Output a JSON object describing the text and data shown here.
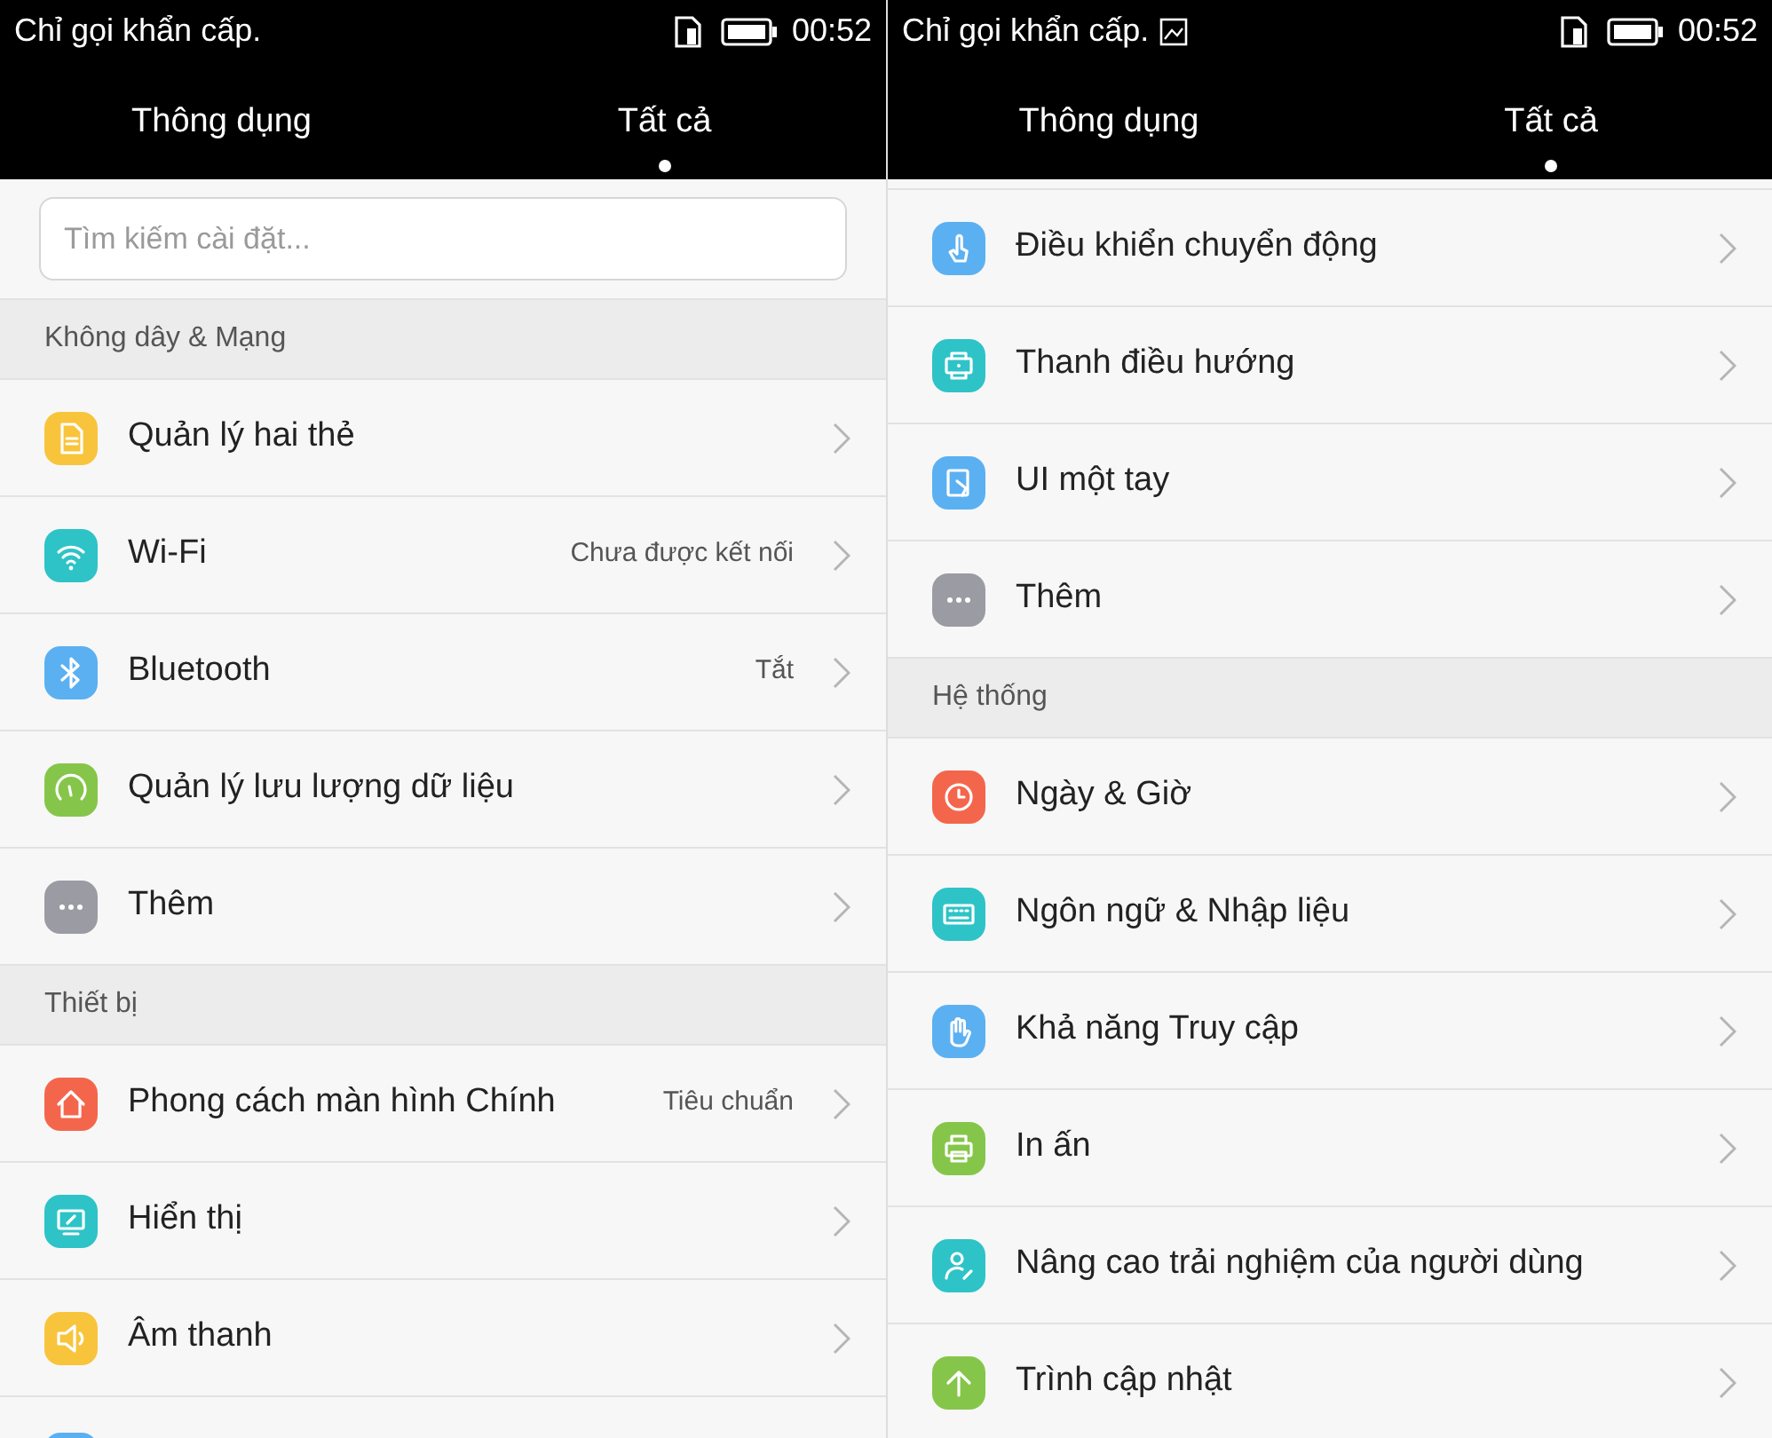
{
  "screens": [
    {
      "status_bar": {
        "carrier": "Chỉ gọi khẩn cấp.",
        "image_notification": false,
        "time": "00:52"
      },
      "tabs": [
        {
          "label": "Thông dụng",
          "selected": false
        },
        {
          "label": "Tất cả",
          "selected": true
        }
      ],
      "search": {
        "placeholder": "Tìm kiếm cài đặt..."
      },
      "sections": [
        {
          "header": "Không dây & Mạng",
          "rows": [
            {
              "kind": "sim",
              "color": "#f8c43c",
              "label": "Quản lý hai thẻ"
            },
            {
              "kind": "wifi",
              "color": "#2ec3c7",
              "label": "Wi-Fi",
              "value": "Chưa được kết nối"
            },
            {
              "kind": "bluetooth",
              "color": "#5bb0f2",
              "label": "Bluetooth",
              "value": "Tắt"
            },
            {
              "kind": "gauge",
              "color": "#85c64a",
              "label": "Quản lý lưu lượng dữ liệu"
            },
            {
              "kind": "more",
              "color": "#9b9ba3",
              "label": "Thêm"
            }
          ]
        },
        {
          "header": "Thiết bị",
          "rows": [
            {
              "kind": "home",
              "color": "#f4664c",
              "label": "Phong cách màn hình Chính",
              "value": "Tiêu chuẩn"
            },
            {
              "kind": "display",
              "color": "#2ec3c7",
              "label": "Hiển thị"
            },
            {
              "kind": "sound",
              "color": "#f8c43c",
              "label": "Âm thanh"
            },
            {
              "kind": "blank",
              "color": "#5bb0f2"
            }
          ]
        }
      ]
    },
    {
      "status_bar": {
        "carrier": "Chỉ gọi khẩn cấp.",
        "image_notification": true,
        "time": "00:52"
      },
      "tabs": [
        {
          "label": "Thông dụng",
          "selected": false
        },
        {
          "label": "Tất cả",
          "selected": true
        }
      ],
      "sections": [
        {
          "rows": [
            {
              "kind": "gesture",
              "color": "#5bb0f2",
              "label": "Điều khiển chuyển động"
            },
            {
              "kind": "navbar",
              "color": "#2ec3c7",
              "label": "Thanh điều hướng"
            },
            {
              "kind": "onehand",
              "color": "#5bb0f2",
              "label": "UI một tay"
            },
            {
              "kind": "more",
              "color": "#9b9ba3",
              "label": "Thêm"
            }
          ]
        },
        {
          "header": "Hệ thống",
          "rows": [
            {
              "kind": "clock",
              "color": "#f4664c",
              "label": "Ngày & Giờ"
            },
            {
              "kind": "keyboard",
              "color": "#2ec3c7",
              "label": "Ngôn ngữ & Nhập liệu"
            },
            {
              "kind": "hand",
              "color": "#5bb0f2",
              "label": "Khả năng Truy cập"
            },
            {
              "kind": "printer",
              "color": "#85c64a",
              "label": "In ấn"
            },
            {
              "kind": "user",
              "color": "#2ec3c7",
              "label": "Nâng cao trải nghiệm của người dùng"
            },
            {
              "kind": "upload",
              "color": "#85c64a",
              "label": "Trình cập nhật"
            }
          ]
        }
      ]
    }
  ]
}
